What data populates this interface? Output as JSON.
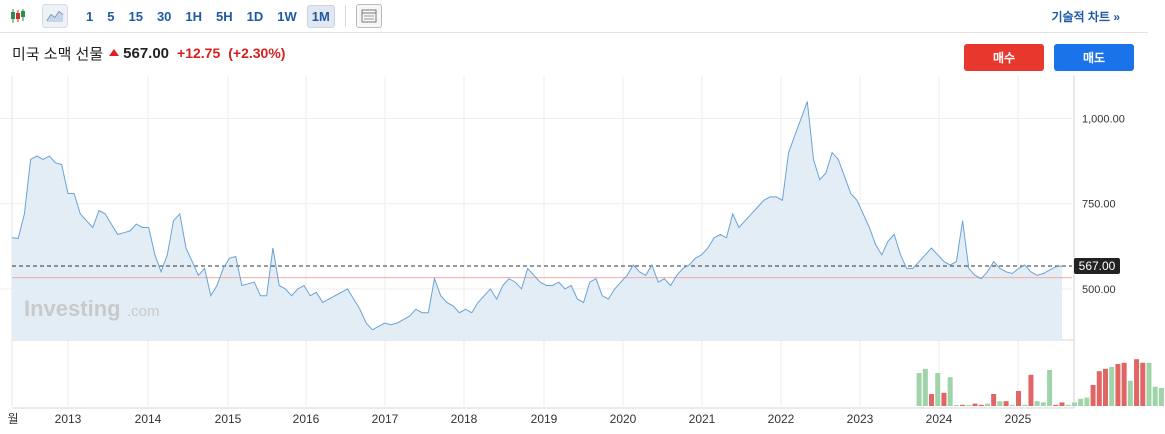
{
  "toolbar": {
    "timeframes": [
      "1",
      "5",
      "15",
      "30",
      "1H",
      "5H",
      "1D",
      "1W",
      "1M"
    ],
    "active_timeframe": "1M",
    "technical_chart_label": "기술적 차트 »",
    "icons": [
      "candlestick-icon",
      "area-chart-icon",
      "table-icon"
    ]
  },
  "instrument": {
    "name": "미국 소맥 선물",
    "price": "567.00",
    "change": "+12.75",
    "change_pct": "(+2.30%)"
  },
  "buttons": {
    "buy": "매수",
    "sell": "매도"
  },
  "watermark": {
    "brand": "Investing",
    "suffix": ".com"
  },
  "colors": {
    "line": "#6aa3d6",
    "area": "#e3edf6",
    "up_volume": "#9fd3a8",
    "down_volume": "#e06666",
    "buy_button": "#e8372c",
    "sell_button": "#1a73e8",
    "price_tag": "#222222"
  },
  "chart_data": {
    "type": "area",
    "x_tick_labels": [
      "월",
      "2013",
      "2014",
      "2015",
      "2016",
      "2017",
      "2018",
      "2019",
      "2020",
      "2021",
      "2022",
      "2023",
      "2024",
      "2025"
    ],
    "y_tick_labels": [
      "1,000.00",
      "750.00",
      "500.00"
    ],
    "ylim": [
      350,
      1110
    ],
    "current_price_label": "567.00",
    "current_price": 567,
    "reference_line": 533,
    "x_start": "2012-08",
    "x_end": "2025-08",
    "series": [
      {
        "values": [
          650,
          648,
          720,
          880,
          890,
          880,
          890,
          870,
          865,
          780,
          780,
          720,
          700,
          680,
          730,
          720,
          690,
          660,
          665,
          670,
          690,
          680,
          680,
          600,
          550,
          600,
          700,
          720,
          620,
          580,
          540,
          560,
          480,
          510,
          560,
          590,
          595,
          510,
          515,
          520,
          480,
          480,
          620,
          510,
          500,
          480,
          500,
          510,
          480,
          490,
          460,
          470,
          480,
          490,
          500,
          470,
          440,
          400,
          380,
          390,
          400,
          395,
          400,
          410,
          420,
          440,
          430,
          430,
          530,
          480,
          460,
          450,
          430,
          440,
          430,
          460,
          480,
          500,
          470,
          510,
          530,
          520,
          500,
          560,
          540,
          520,
          510,
          510,
          520,
          500,
          510,
          470,
          460,
          520,
          530,
          480,
          470,
          500,
          520,
          540,
          570,
          550,
          540,
          570,
          520,
          530,
          510,
          540,
          560,
          570,
          590,
          600,
          620,
          650,
          660,
          650,
          720,
          680,
          700,
          720,
          740,
          760,
          770,
          770,
          760,
          900,
          950,
          1000,
          1050,
          880,
          820,
          840,
          900,
          880,
          830,
          780,
          760,
          720,
          680,
          630,
          600,
          640,
          660,
          600,
          560,
          560,
          580,
          600,
          620,
          600,
          580,
          570,
          580,
          700,
          560,
          540,
          530,
          550,
          580,
          560,
          550,
          545,
          560,
          570,
          550,
          540,
          545,
          555,
          565,
          567
        ]
      }
    ],
    "volume": {
      "start_index": 146,
      "values": [
        0.55,
        0.62,
        0.2,
        0.55,
        0.22,
        0.48,
        0.0,
        0.02,
        0.0,
        0.04,
        0.02,
        0.04,
        0.2,
        0.08,
        0.08,
        0.02,
        0.25,
        0.02,
        0.52,
        0.08,
        0.06,
        0.6,
        0.02,
        0.06,
        0.02,
        0.06,
        0.12,
        0.14,
        0.35,
        0.58,
        0.62,
        0.65,
        0.7,
        0.72,
        0.42,
        0.78,
        0.72,
        0.72,
        0.32,
        0.3,
        0.3,
        0.76,
        0.74,
        0.72,
        0.72,
        0.62,
        0.6,
        0.4
      ],
      "down": [
        false,
        false,
        true,
        false,
        true,
        false,
        false,
        true,
        false,
        true,
        true,
        false,
        true,
        false,
        true,
        false,
        true,
        false,
        true,
        false,
        false,
        false,
        true,
        true,
        false,
        false,
        false,
        false,
        true,
        true,
        true,
        false,
        true,
        true,
        false,
        true,
        true,
        false,
        false,
        false,
        true,
        true,
        true,
        false,
        true,
        true,
        true,
        false
      ]
    }
  }
}
